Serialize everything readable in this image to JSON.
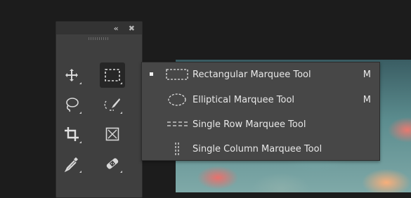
{
  "panel": {
    "collapse_glyph": "«",
    "close_glyph": "✖",
    "tools": [
      {
        "icon": "move-tool-icon"
      },
      {
        "icon": "rectangular-marquee-tool-icon",
        "active": true
      },
      {
        "icon": "lasso-tool-icon"
      },
      {
        "icon": "quick-selection-tool-icon"
      },
      {
        "icon": "crop-tool-icon"
      },
      {
        "icon": "frame-tool-icon"
      },
      {
        "icon": "eyedropper-tool-icon"
      },
      {
        "icon": "spot-healing-brush-tool-icon"
      }
    ]
  },
  "flyout": {
    "items": [
      {
        "label": "Rectangular Marquee Tool",
        "shortcut": "M",
        "selected": true,
        "icon": "rectangular-marquee-icon"
      },
      {
        "label": "Elliptical Marquee Tool",
        "shortcut": "M",
        "selected": false,
        "icon": "elliptical-marquee-icon"
      },
      {
        "label": "Single Row Marquee Tool",
        "shortcut": "",
        "selected": false,
        "icon": "single-row-marquee-icon"
      },
      {
        "label": "Single Column Marquee Tool",
        "shortcut": "",
        "selected": false,
        "icon": "single-column-marquee-icon"
      }
    ]
  },
  "colors": {
    "panel_bg": "#3f3f3f",
    "flyout_bg": "#474747",
    "text": "#e8e8e8",
    "app_bg": "#1c1c1c"
  }
}
